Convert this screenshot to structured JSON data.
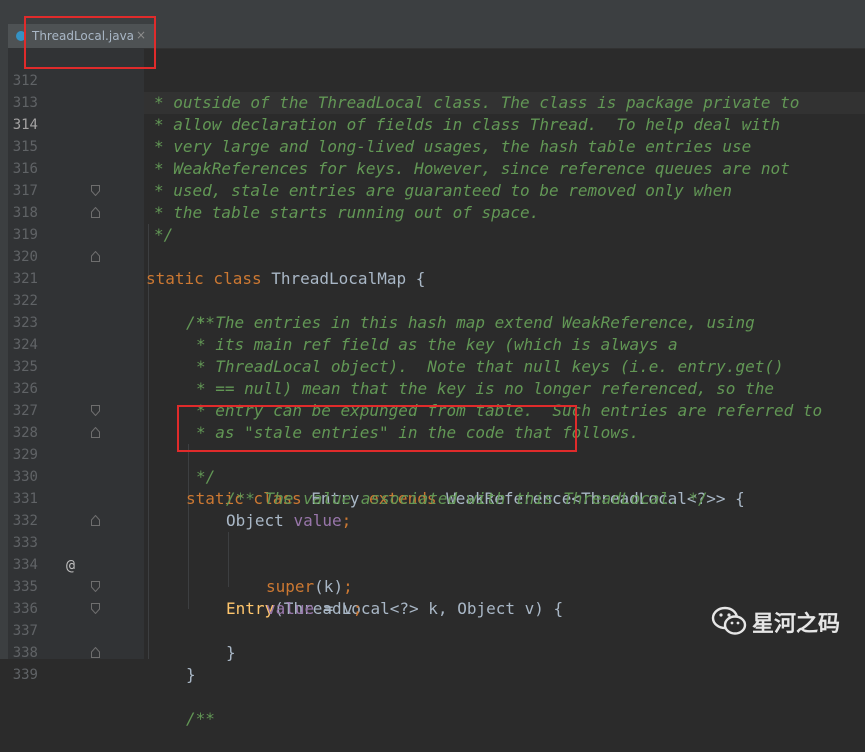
{
  "editor": {
    "tab_label": "ThreadLocal.java",
    "tab_close": "×",
    "tab_icon": "java-class-icon"
  },
  "watermark": {
    "text": "星河之码",
    "icon": "wechat-icon"
  },
  "lines": [
    {
      "n": "312",
      "text": "* outside of the ThreadLocal class. The class is package private to"
    },
    {
      "n": "313",
      "text": "* allow declaration of fields in class Thread.  To help deal with"
    },
    {
      "n": "314",
      "text": "* very large and long-lived usages, the hash table entries use"
    },
    {
      "n": "315",
      "text": "* WeakReferences for keys. However, since reference queues are not"
    },
    {
      "n": "316",
      "text": "* used, stale entries are guaranteed to be removed only when"
    },
    {
      "n": "317",
      "text": "* the table starts running out of space."
    },
    {
      "n": "318",
      "text": "*/"
    },
    {
      "n": "319",
      "kw": "static class ",
      "id": "ThreadLocalMap ",
      "brace": "{"
    },
    {
      "n": "320",
      "text": ""
    },
    {
      "n": "321",
      "text": "/**"
    },
    {
      "n": "322",
      "text": "* The entries in this hash map extend WeakReference, using"
    },
    {
      "n": "323",
      "text": "* its main ref field as the key (which is always a"
    },
    {
      "n": "324",
      "text": "* ThreadLocal object).  Note that null keys (i.e. entry.get()"
    },
    {
      "n": "325",
      "text": "* == null) mean that the key is no longer referenced, so the"
    },
    {
      "n": "326",
      "text": "* entry can be expunged from table.  Such entries are referred to"
    },
    {
      "n": "327",
      "text": "* as \"stale entries\" in the code that follows."
    },
    {
      "n": "328",
      "text": "*/"
    },
    {
      "n": "329",
      "kw": "static class ",
      "id": "Entry ",
      "kw2": "extends ",
      "id2": "WeakReference",
      "gen": "<ThreadLocal<?>> ",
      "brace": "{"
    },
    {
      "n": "330",
      "text": "/** The value associated with this ThreadLocal. */"
    },
    {
      "n": "331",
      "type": "Object ",
      "field": "value",
      "semi": ";"
    },
    {
      "n": "332",
      "text": ""
    },
    {
      "n": "333",
      "method": "Entry",
      "args": "(ThreadLocal<?> k, Object v) ",
      "brace": "{"
    },
    {
      "n": "334",
      "kw": "super",
      "args": "(k)",
      "semi": ";"
    },
    {
      "n": "335",
      "field": "value",
      "args": " = v",
      "semi": ";"
    },
    {
      "n": "336",
      "brace": "}"
    },
    {
      "n": "337",
      "brace": "}"
    },
    {
      "n": "338",
      "text": ""
    },
    {
      "n": "339",
      "text": "/**"
    }
  ],
  "gutter_marker": "@"
}
